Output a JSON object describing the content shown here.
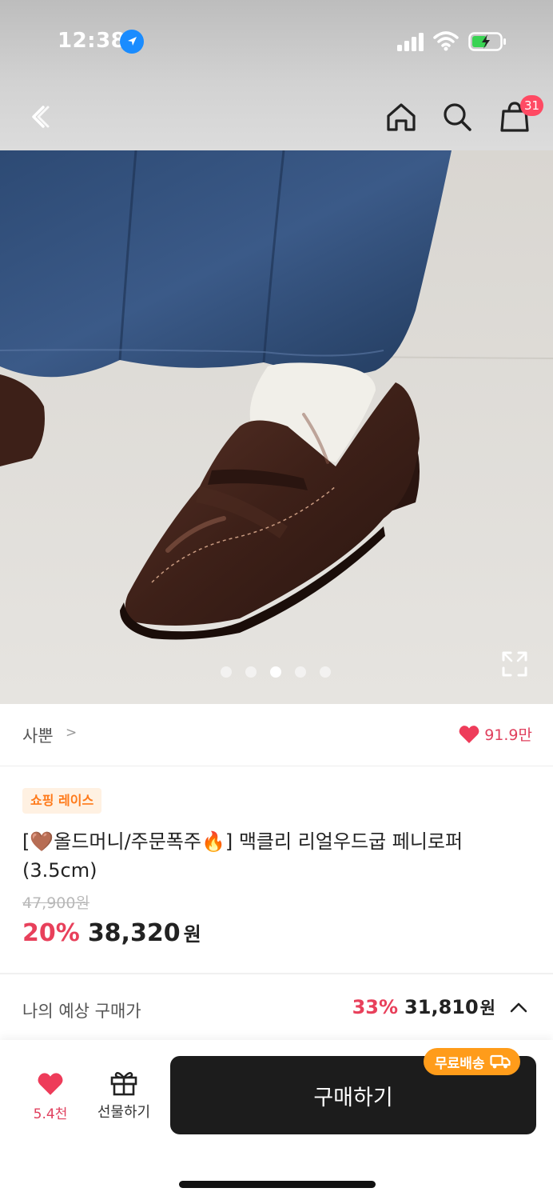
{
  "status_bar": {
    "time": "12:38",
    "battery_charging": true
  },
  "nav": {
    "cart_count": "31"
  },
  "photo": {
    "carousel_total": 5,
    "carousel_active_index": 2
  },
  "seller": {
    "name": "사뿐",
    "chevron": ">",
    "like_count": "91.9만"
  },
  "product": {
    "badge": "쇼핑 레이스",
    "title": "[🤎올드머니/주문폭주🔥] 맥클리 리얼우드굽 페니로퍼 (3.5cm)",
    "original_price": "47,900원",
    "discount": "20%",
    "price": "38,320",
    "currency": "원"
  },
  "expected": {
    "label": "나의 예상 구매가",
    "discount": "33%",
    "price": "31,810",
    "currency": "원"
  },
  "bottom": {
    "like_count": "5.4천",
    "gift_label": "선물하기",
    "buy_label": "구매하기",
    "free_shipping": "무료배송"
  },
  "colors": {
    "accent": "#e8405b",
    "buy_button": "#1c1c1c",
    "free_shipping": "#ff9c1a",
    "badge_bg": "#fff1e2",
    "badge_text": "#ff7a1a"
  }
}
